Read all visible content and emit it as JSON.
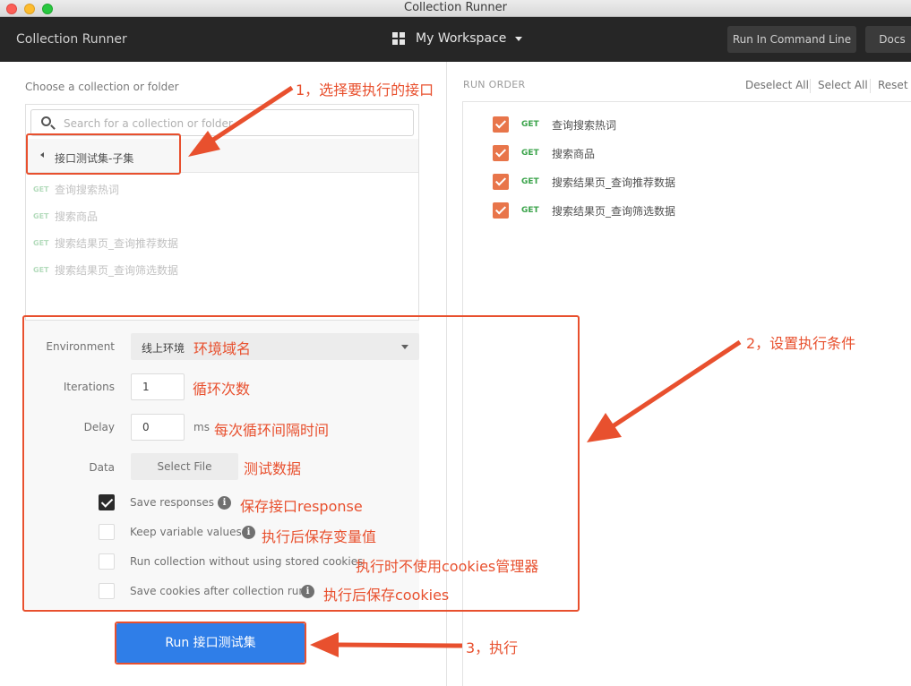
{
  "window": {
    "title": "Collection Runner"
  },
  "header": {
    "app_title": "Collection Runner",
    "workspace": "My Workspace",
    "run_cli_label": "Run In Command Line",
    "docs_label": "Docs"
  },
  "left": {
    "choose_label": "Choose a collection or folder",
    "search_placeholder": "Search for a collection or folder",
    "folder_name": "接口测试集-子集",
    "requests": [
      {
        "method": "GET",
        "name": "查询搜索热词"
      },
      {
        "method": "GET",
        "name": "搜索商品"
      },
      {
        "method": "GET",
        "name": "搜索结果页_查询推荐数据"
      },
      {
        "method": "GET",
        "name": "搜索结果页_查询筛选数据"
      }
    ],
    "settings": {
      "environment_label": "Environment",
      "environment_value": "线上环境",
      "iterations_label": "Iterations",
      "iterations_value": "1",
      "delay_label": "Delay",
      "delay_value": "0",
      "delay_unit": "ms",
      "data_label": "Data",
      "select_file_label": "Select File",
      "options": [
        {
          "label": "Save responses",
          "checked": true
        },
        {
          "label": "Keep variable values",
          "checked": false
        },
        {
          "label": "Run collection without using stored cookies",
          "checked": false
        },
        {
          "label": "Save cookies after collection run",
          "checked": false
        }
      ]
    },
    "run_button": "Run 接口测试集"
  },
  "right": {
    "run_order_label": "RUN ORDER",
    "deselect_all": "Deselect All",
    "select_all": "Select All",
    "reset": "Reset",
    "items": [
      {
        "method": "GET",
        "name": "查询搜索热词",
        "checked": true
      },
      {
        "method": "GET",
        "name": "搜索商品",
        "checked": true
      },
      {
        "method": "GET",
        "name": "搜索结果页_查询推荐数据",
        "checked": true
      },
      {
        "method": "GET",
        "name": "搜索结果页_查询筛选数据",
        "checked": true
      }
    ]
  },
  "annotations": {
    "step1": "1，选择要执行的接口",
    "step2": "2，设置执行条件",
    "step3": "3，执行",
    "env_note": "环境域名",
    "iter_note": "循环次数",
    "delay_note": "每次循环间隔时间",
    "data_note": "测试数据",
    "save_resp_note": "保存接口response",
    "keep_var_note": "执行后保存变量值",
    "no_cookie_note": "执行时不使用cookies管理器",
    "save_cookie_note": "执行后保存cookies"
  },
  "colors": {
    "accent_orange": "#e8754a",
    "annotation_red": "#e8502e",
    "run_blue": "#2f7ee8",
    "header_dark": "#262626",
    "get_green": "#3aa34a"
  }
}
